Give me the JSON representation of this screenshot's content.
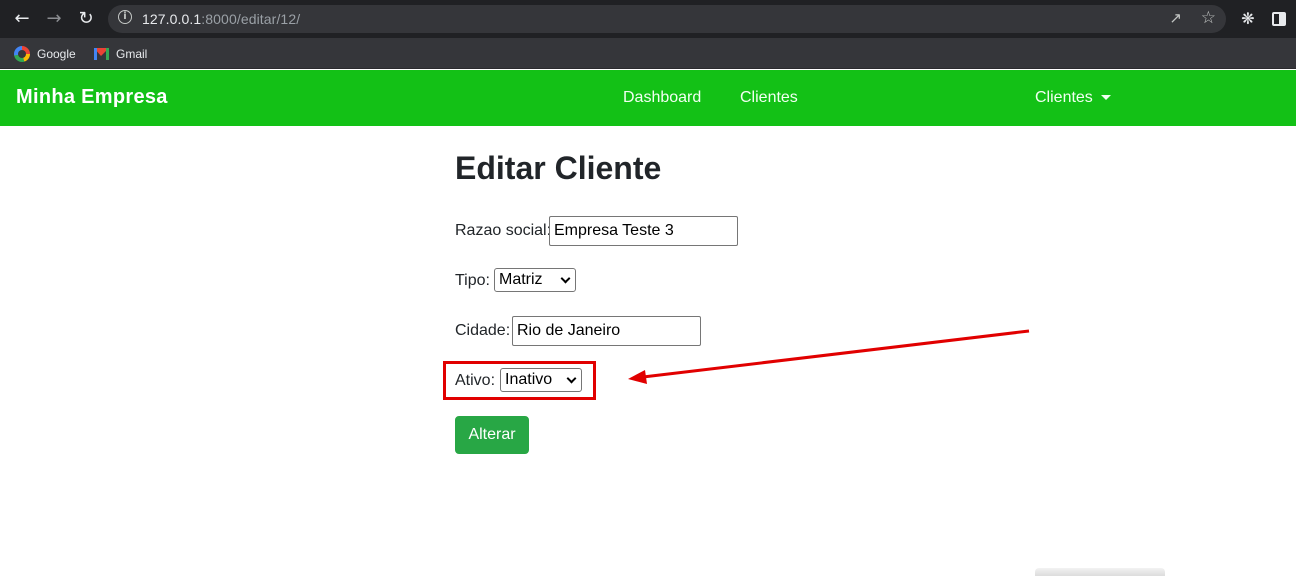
{
  "browser": {
    "url_host": "127.0.0.1",
    "url_rest": ":8000/editar/12/",
    "bookmarks": [
      {
        "label": "Google",
        "icon": "google-icon"
      },
      {
        "label": "Gmail",
        "icon": "gmail-icon"
      }
    ],
    "icons": {
      "back": "back-arrow-icon",
      "forward": "forward-arrow-icon",
      "reload": "reload-icon",
      "info": "info-icon",
      "share": "share-icon",
      "bookmark": "star-icon",
      "extensions": "puzzle-icon",
      "side_panel": "side-panel-icon"
    }
  },
  "navbar": {
    "brand": "Minha Empresa",
    "links": [
      "Dashboard",
      "Clientes"
    ],
    "dropdown": "Clientes",
    "color": "#13c116"
  },
  "form": {
    "title": "Editar Cliente",
    "razao_social": {
      "label": "Razao social:",
      "value": "Empresa Teste 3"
    },
    "tipo": {
      "label": "Tipo:",
      "selected": "Matriz"
    },
    "cidade": {
      "label": "Cidade:",
      "value": "Rio de Janeiro"
    },
    "ativo": {
      "label": "Ativo:",
      "selected": "Inativo"
    },
    "submit_label": "Alterar",
    "submit_color": "#28a745"
  },
  "annotation": {
    "color": "#e10000"
  }
}
